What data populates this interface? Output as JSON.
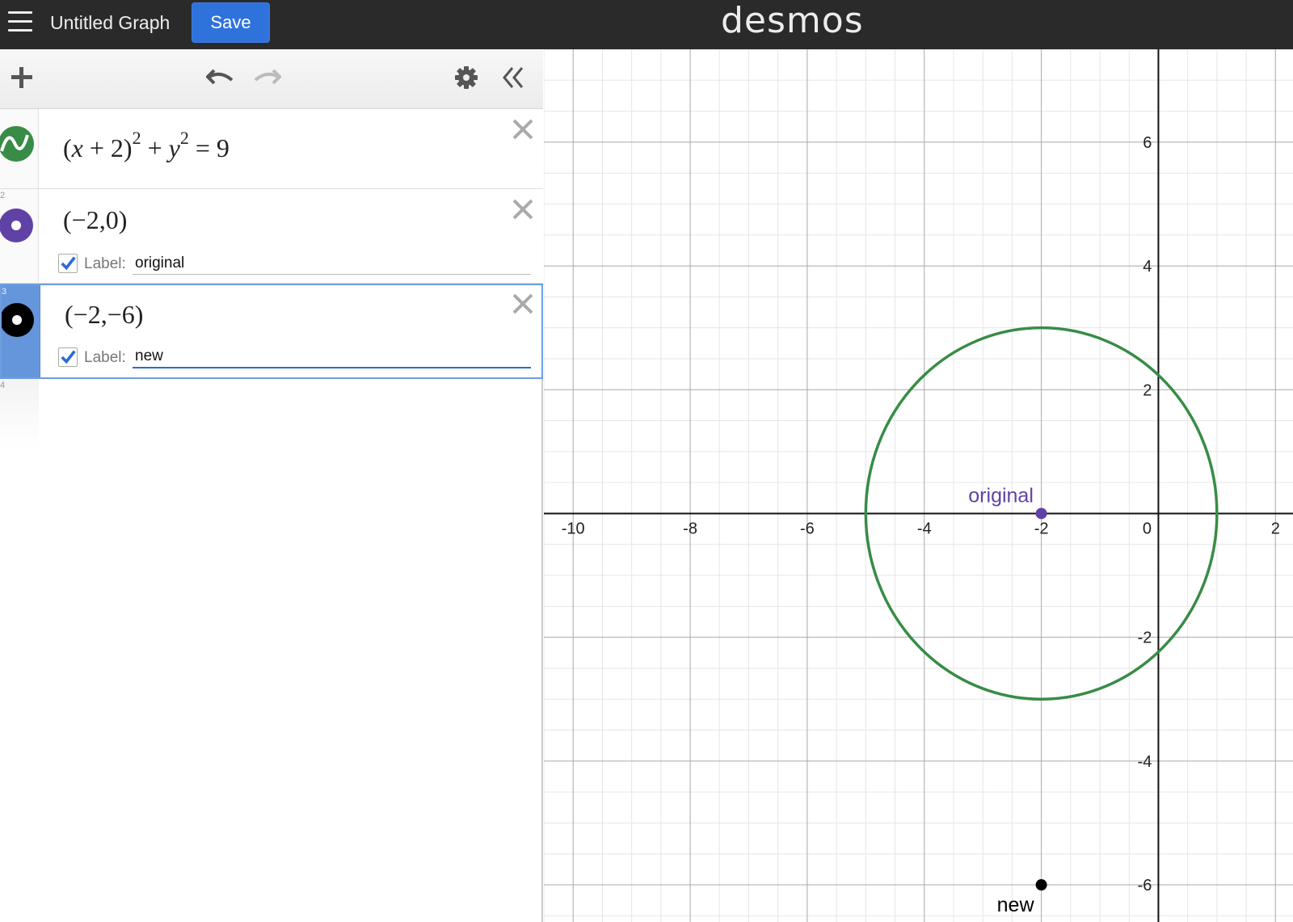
{
  "header": {
    "title": "Untitled Graph",
    "save_label": "Save",
    "logo": "desmos"
  },
  "toolbar": {
    "add_icon": "plus-icon",
    "undo_icon": "undo-icon",
    "redo_icon": "redo-icon",
    "settings_icon": "gear-icon",
    "collapse_icon": "double-chevron-left-icon"
  },
  "expressions": [
    {
      "index": "1",
      "latex": "(x+2)^2+y^2=9",
      "color": "#388c46",
      "type": "implicit"
    },
    {
      "index": "2",
      "latex": "(-2,0)",
      "color": "#6042a6",
      "type": "point",
      "label_checked": true,
      "label_caption": "Label:",
      "label": "original"
    },
    {
      "index": "3",
      "latex": "(-2,-6)",
      "color": "#000000",
      "type": "point",
      "label_checked": true,
      "label_caption": "Label:",
      "label": "new"
    },
    {
      "index": "4"
    }
  ],
  "graph": {
    "xlim": [
      -10.5,
      2.3
    ],
    "ylim": [
      -6.6,
      7.5
    ],
    "x_ticks": [
      "-10",
      "-8",
      "-6",
      "-4",
      "-2",
      "0",
      "2"
    ],
    "y_ticks": [
      "6",
      "4",
      "2",
      "-2",
      "-4",
      "-6"
    ],
    "circle": {
      "center": [
        -2,
        0
      ],
      "radius": 3,
      "color": "#388c46"
    },
    "points": [
      {
        "x": -2,
        "y": 0,
        "label": "original",
        "color": "#6042a6"
      },
      {
        "x": -2,
        "y": -6,
        "label": "new",
        "color": "#000000"
      }
    ]
  }
}
